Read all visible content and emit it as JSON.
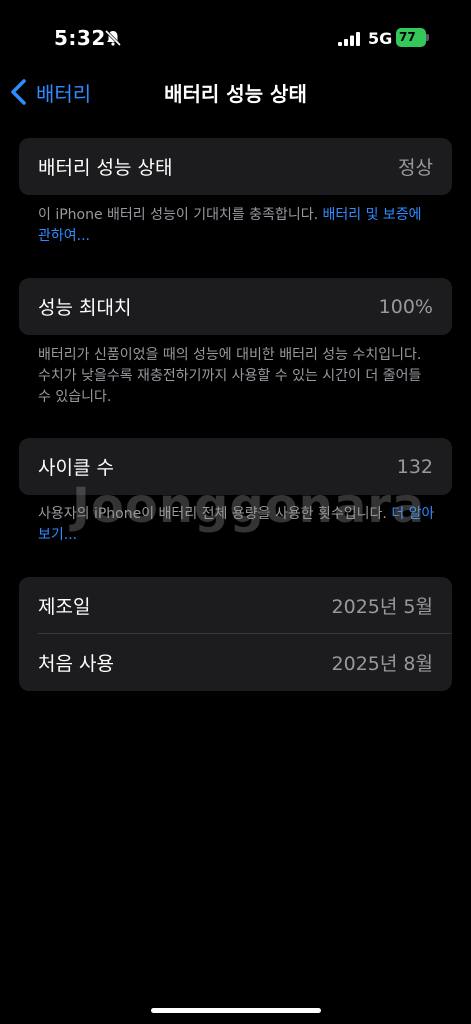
{
  "status_bar": {
    "time": "5:32",
    "network": "5G",
    "battery_level": "77",
    "icons": [
      "bell-slash-icon",
      "signal-bars-icon",
      "battery-icon"
    ]
  },
  "nav": {
    "back_label": "배터리",
    "title": "배터리 성능 상태"
  },
  "health": {
    "label": "배터리 성능 상태",
    "value": "정상",
    "note_text": "이 iPhone 배터리 성능이 기대치를 충족합니다. ",
    "note_link": "배터리 및 보증에 관하여..."
  },
  "capacity": {
    "label": "성능 최대치",
    "value": "100%",
    "note_text": "배터리가 신품이었을 때의 성능에 대비한 배터리 성능 수치입니다. 수치가 낮을수록 재충전하기까지 사용할 수 있는 시간이 더 줄어들 수 있습니다."
  },
  "cycles": {
    "label": "사이클 수",
    "value": "132",
    "note_text": "사용자의 iPhone이 배터리 전체 용량을 사용한 횟수입니다. ",
    "note_link": "더 알아보기..."
  },
  "dates": {
    "manufacture_label": "제조일",
    "manufacture_value": "2025년 5월",
    "first_use_label": "처음 사용",
    "first_use_value": "2025년 8월"
  },
  "watermark": "Joonggonara",
  "colors": {
    "accent": "#2f8cff",
    "battery_green": "#34c759",
    "cell_bg": "#1c1c1e",
    "secondary_text": "#98989f"
  }
}
